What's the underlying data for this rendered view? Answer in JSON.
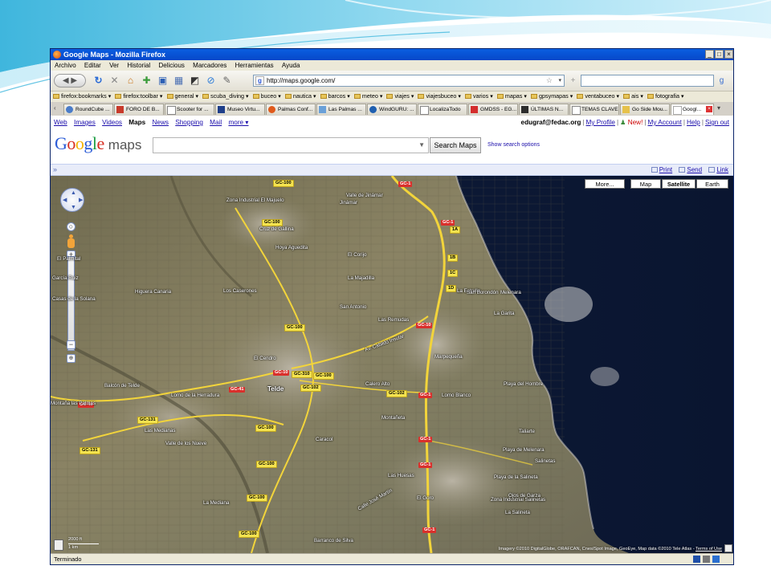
{
  "browser": {
    "window_title": "Google Maps - Mozilla Firefox",
    "menu": [
      "Archivo",
      "Editar",
      "Ver",
      "Historial",
      "Delicious",
      "Marcadores",
      "Herramientas",
      "Ayuda"
    ],
    "url": "http://maps.google.com/",
    "bookmarks": [
      "firefox:bookmarks",
      "firefox:toolbar",
      "general",
      "scuba_diving",
      "buceo",
      "nautica",
      "barcos",
      "meteo",
      "viajes",
      "viajesbuceo",
      "varios",
      "mapas",
      "gpsymapas",
      "ventabuceo",
      "ais",
      "fotografia"
    ],
    "tabs": [
      "RoundCube ...",
      "FORO DE B...",
      "Scooter for ...",
      "Museo Virtu...",
      "Palmas Conf...",
      "Las Palmas ...",
      "WindGURU: ...",
      "LocalizaTodo",
      "GMDSS - EG...",
      "ÚLTIMAS N...",
      "TEMAS CLAVE",
      "Go Side Mou...",
      "Googl..."
    ],
    "status": "Terminado"
  },
  "google": {
    "nav": [
      "Web",
      "Images",
      "Videos",
      "Maps",
      "News",
      "Shopping",
      "Mail",
      "more ▾"
    ],
    "active_nav": "Maps",
    "user_email": "edugraf@fedac.org",
    "links": [
      "My Profile",
      "New!",
      "My Account",
      "Help",
      "Sign out"
    ],
    "logo_word": "Google",
    "logo_suffix": "maps",
    "search_button": "Search Maps",
    "search_options": "Show search options",
    "strip_chevron": "»",
    "actions": [
      "Print",
      "Send",
      "Link"
    ]
  },
  "map": {
    "map_types": [
      "More...",
      "Map",
      "Satellite",
      "Earth"
    ],
    "selected_type": "Satellite",
    "scale": [
      "2000 ft",
      "1 km"
    ],
    "copyright": "Imagery ©2010 DigitalGlobe, ORAFCAN, Cnes/Spot Image, GeoEye, Map data ©2010 Tele Atlas",
    "terms": "Terms of Use",
    "road_labels": [
      "GC-1",
      "GC-100",
      "GC-10",
      "GC-310",
      "GC-102",
      "GC-41",
      "GC-131",
      "1A",
      "1B",
      "1C",
      "1D"
    ],
    "places": [
      "Zona Industrial El Majuelo",
      "Valle de Jinámar",
      "Jinámar",
      "Cruz de Gallina",
      "Hoya Aguedita",
      "El Corijo",
      "La Majadilla",
      "Higuera Canaria",
      "Los Caserones",
      "San Antonio",
      "Las Remudas",
      "La Estrella",
      "San Borondón",
      "Melenara",
      "La Garita",
      "Marpequeña",
      "Telde",
      "El Cendro",
      "Lomo de la Herradura",
      "Balcón de Telde",
      "Montaña las Palmas",
      "Las Medianas",
      "Valle de los Nueve",
      "Caracol",
      "Calero Alto",
      "Lomo Blanco",
      "Montañeta",
      "Playa del Hombre",
      "Taliarte",
      "Playa de Melenara",
      "Las Huesas",
      "El Goro",
      "Zona Industrial Salinetas",
      "La Salineta",
      "Playa de la Salineta",
      "Barranco de Silva",
      "La Mediana",
      "Casas de la Solana",
      "García Ruiz",
      "El Palmital",
      "Salinetas",
      "Ojos de Garza",
      "Calle José Martín",
      "Av. Cabildo Insular"
    ]
  },
  "colors": {
    "title_bar": "#0648c9",
    "link": "#1a0dab",
    "ocean": "#0d1830",
    "slide_accent": "#3fb6dd"
  }
}
